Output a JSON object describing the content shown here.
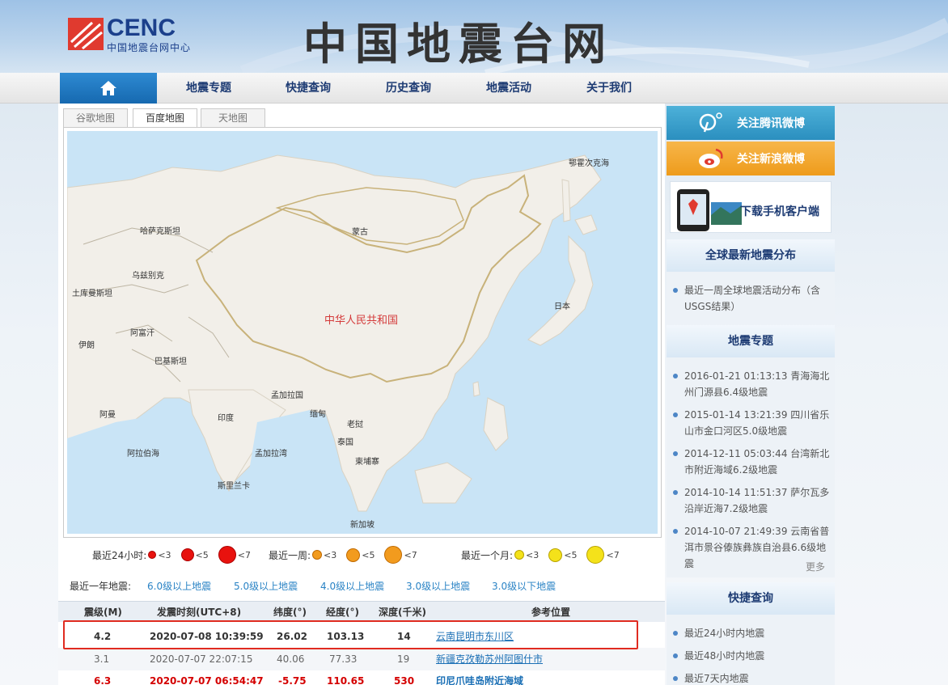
{
  "header": {
    "logo_text": "CENC",
    "logo_sub": "中国地震台网中心",
    "site_title": "中国地震台网"
  },
  "nav": {
    "home_icon": "home-icon",
    "items": [
      "地震专题",
      "快捷查询",
      "历史查询",
      "地震活动",
      "关于我们"
    ]
  },
  "map": {
    "tabs": [
      "谷歌地图",
      "百度地图",
      "天地图"
    ],
    "active_tab": "百度地图",
    "labels": {
      "sea_okhotsk": "鄂霍次克海",
      "kazakhstan": "哈萨克斯坦",
      "mongolia": "蒙古",
      "uzbekistan": "乌兹别克",
      "turkmenistan": "土库曼斯坦",
      "china": "中华人民共和国",
      "japan": "日本",
      "afghanistan": "阿富汗",
      "iran": "伊朗",
      "pakistan": "巴基斯坦",
      "bangladesh": "孟加拉国",
      "myanmar": "缅甸",
      "laos": "老挝",
      "oman": "阿曼",
      "india": "印度",
      "thailand": "泰国",
      "arabian_sea": "阿拉伯海",
      "bay_of_bengal": "孟加拉湾",
      "cambodia": "柬埔寨",
      "sri_lanka": "斯里兰卡",
      "singapore": "新加坡"
    },
    "colors": {
      "land": "#f2efe9",
      "sea": "#c9e4f6",
      "border": "#c8b27a",
      "china_label": "#d43a3a"
    }
  },
  "legend": {
    "day_label": "最近24小时:",
    "week_label": "最近一周:",
    "month_label": "最近一个月:",
    "m3": "<3",
    "m5": "<5",
    "m7": "<7",
    "colors": {
      "day": "#e8120e",
      "week": "#f29b1e",
      "month": "#f4e21a"
    }
  },
  "year_quakes": {
    "label": "最近一年地震:",
    "links": [
      "6.0级以上地震",
      "5.0级以上地震",
      "4.0级以上地震",
      "3.0级以上地震",
      "3.0级以下地震"
    ]
  },
  "table": {
    "headers": [
      "震级(M)",
      "发震时刻(UTC+8)",
      "纬度(°)",
      "经度(°)",
      "深度(千米)",
      "参考位置"
    ],
    "rows": [
      {
        "mag": "4.2",
        "time": "2020-07-08 10:39:59",
        "lat": "26.02",
        "lon": "103.13",
        "depth": "14",
        "place": "云南昆明市东川区"
      },
      {
        "mag": "3.1",
        "time": "2020-07-07 22:07:15",
        "lat": "40.06",
        "lon": "77.33",
        "depth": "19",
        "place": "新疆克孜勒苏州阿图什市"
      },
      {
        "mag": "6.3",
        "time": "2020-07-07 06:54:47",
        "lat": "-5.75",
        "lon": "110.65",
        "depth": "530",
        "place": "印尼爪哇岛附近海域"
      }
    ]
  },
  "sidebar": {
    "tencent_weibo": "关注腾讯微博",
    "sina_weibo": "关注新浪微博",
    "app_download": "下载手机客户端",
    "global_head": "全球最新地震分布",
    "global_items": [
      "最近一周全球地震活动分布（含USGS结果）"
    ],
    "topic_head": "地震专题",
    "topic_items": [
      "2016-01-21 01:13:13 青海海北州门源县6.4级地震",
      "2015-01-14 13:21:39 四川省乐山市金口河区5.0级地震",
      "2014-12-11 05:03:44 台湾新北市附近海域6.2级地震",
      "2014-10-14 11:51:37 萨尔瓦多沿岸近海7.2级地震",
      "2014-10-07 21:49:39 云南省普洱市景谷傣族彝族自治县6.6级地震"
    ],
    "more": "更多",
    "quick_head": "快捷查询",
    "quick_items": [
      "最近24小时内地震",
      "最近48小时内地震",
      "最近7天内地震"
    ],
    "colors": {
      "tencent": "#3a9ec9",
      "sina": "#f0a229"
    }
  }
}
